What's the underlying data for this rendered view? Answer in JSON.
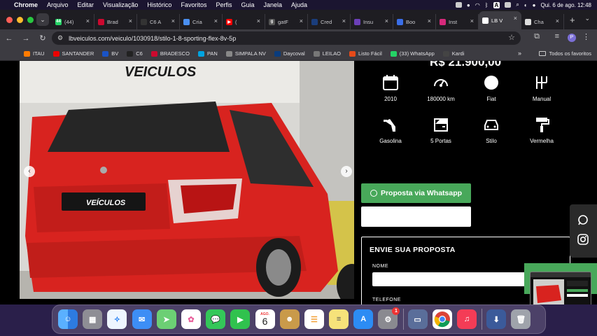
{
  "menubar": {
    "app": "Chrome",
    "items": [
      "Arquivo",
      "Editar",
      "Visualização",
      "Histórico",
      "Favoritos",
      "Perfis",
      "Guia",
      "Janela",
      "Ajuda"
    ],
    "clock": "Qui. 6 de ago.  12:48",
    "input_source": "A"
  },
  "tabs": [
    {
      "label": "(44)",
      "color": "#25d366",
      "glyph": "44"
    },
    {
      "label": "Brad",
      "color": "#cc092f",
      "glyph": ""
    },
    {
      "label": "C6 A",
      "color": "#333333",
      "glyph": ""
    },
    {
      "label": "Cria",
      "color": "#4a8ff0",
      "glyph": ""
    },
    {
      "label": "(",
      "color": "#ff0000",
      "glyph": "▶"
    },
    {
      "label": "gatF",
      "color": "#555555",
      "glyph": "g"
    },
    {
      "label": "Cred",
      "color": "#1a3d7c",
      "glyph": ""
    },
    {
      "label": "Insu",
      "color": "#6b3fb8",
      "glyph": ""
    },
    {
      "label": "Boo",
      "color": "#3a6ee8",
      "glyph": ""
    },
    {
      "label": "Inst",
      "color": "#d6297b",
      "glyph": ""
    },
    {
      "label": "LB V",
      "color": "#ffffff",
      "glyph": "",
      "active": true
    },
    {
      "label": "Cha",
      "color": "#dddddd",
      "glyph": ""
    }
  ],
  "url": "lbveiculos.com/veiculo/1030918/stilo-1-8-sporting-flex-8v-5p",
  "profile_initial": "P",
  "bookmarks": [
    {
      "label": "ITAU",
      "color": "#ff7b00"
    },
    {
      "label": "SANTANDER",
      "color": "#ec0000"
    },
    {
      "label": "BV",
      "color": "#1a53c5"
    },
    {
      "label": "C6",
      "color": "#222222"
    },
    {
      "label": "BRADESCO",
      "color": "#cc092f"
    },
    {
      "label": "PAN",
      "color": "#00a3e0"
    },
    {
      "label": "SIMPALA NV",
      "color": "#888888"
    },
    {
      "label": "Daycoval",
      "color": "#0a3c7d"
    },
    {
      "label": "LEILAO",
      "color": "#777777"
    },
    {
      "label": "Listo Fácil",
      "color": "#e64a19"
    },
    {
      "label": "(33) WhatsApp",
      "color": "#25d366"
    },
    {
      "label": "Kardi",
      "color": "#444444"
    }
  ],
  "bookmarks_more": "»",
  "all_favorites": "Todos os favoritos",
  "listing": {
    "price": "R$ 21.900,00",
    "photo_sign": "VEICULOS",
    "photo_plate": "VEÍCULOS",
    "specs": [
      {
        "label": "2010",
        "icon": "calendar-icon"
      },
      {
        "label": "180000 km",
        "icon": "speedometer-icon"
      },
      {
        "label": "Fiat",
        "icon": "brand-icon"
      },
      {
        "label": "Manual",
        "icon": "gearshift-icon"
      },
      {
        "label": "Gasolina",
        "icon": "fuel-pump-icon"
      },
      {
        "label": "5 Portas",
        "icon": "car-door-icon"
      },
      {
        "label": "Stilo",
        "icon": "car-icon"
      },
      {
        "label": "Vermelha",
        "icon": "paint-roller-icon"
      }
    ],
    "whatsapp_button": "Proposta via Whatsapp",
    "form": {
      "title": "ENVIE SUA PROPOSTA",
      "name_label": "NOME",
      "phone_label": "TELEFONE"
    }
  },
  "colors": {
    "accent_green": "#48a85a",
    "car_red": "#d8231f"
  },
  "dock": {
    "calendar_month": "AGO.",
    "calendar_day": "6",
    "settings_badge": "1"
  }
}
